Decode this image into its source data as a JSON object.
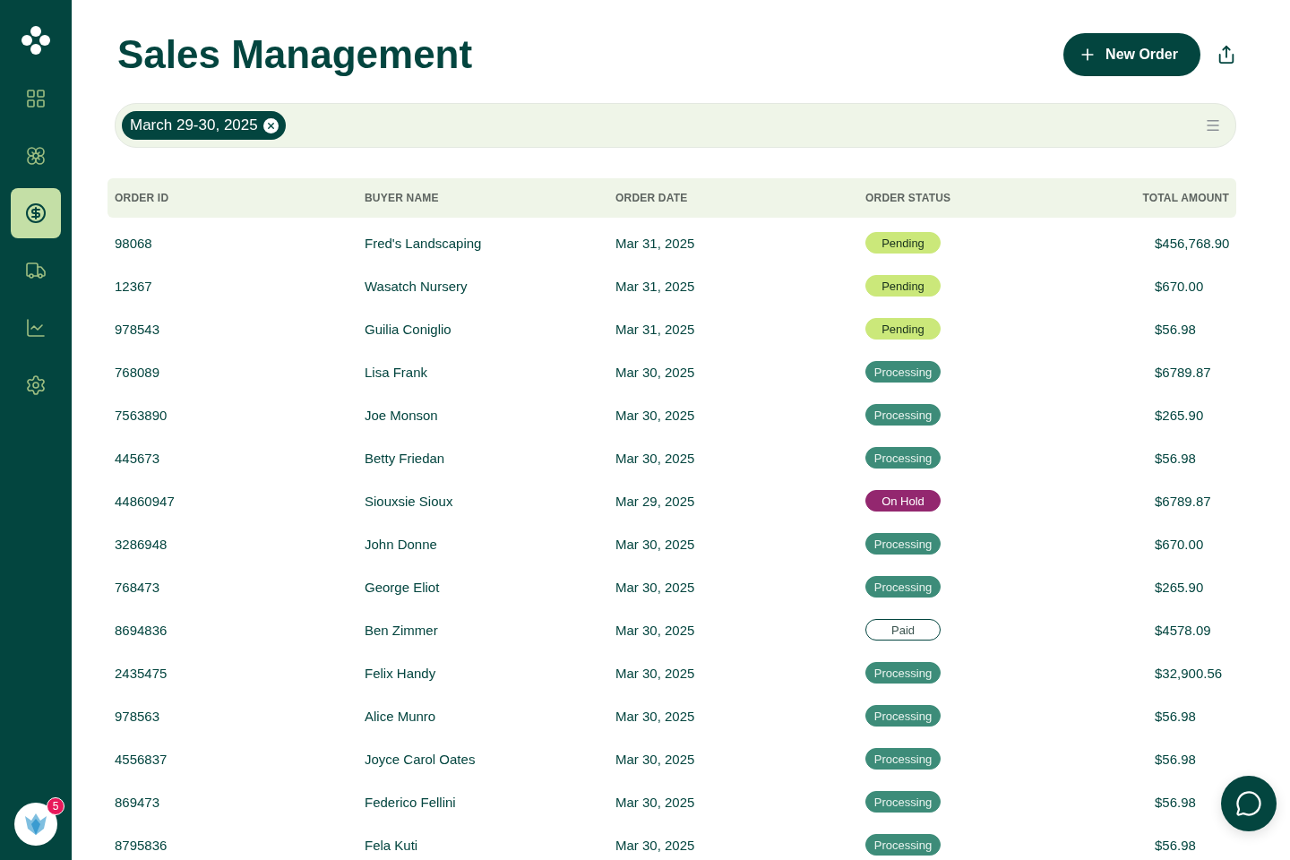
{
  "sidebar": {
    "items": [
      {
        "kind": "grid",
        "selected": false
      },
      {
        "kind": "flower",
        "selected": false
      },
      {
        "kind": "dollar",
        "selected": true
      },
      {
        "kind": "truck",
        "selected": false
      },
      {
        "kind": "chart",
        "selected": false
      },
      {
        "kind": "settings",
        "selected": false
      }
    ],
    "notification_count": "5"
  },
  "header": {
    "title": "Sales Management",
    "new_order_button": "New Order"
  },
  "filter_bar": {
    "chips": [
      "March 29-30, 2025"
    ]
  },
  "table": {
    "columns": [
      "ORDER ID",
      "BUYER NAME",
      "ORDER DATE",
      "ORDER STATUS",
      "TOTAL AMOUNT"
    ],
    "rows": [
      {
        "id": "98068",
        "buyer": "Fred's Landscaping",
        "date": "Mar 31, 2025",
        "status": "Pending",
        "kind": "pending",
        "total": "$456,768.90"
      },
      {
        "id": "12367",
        "buyer": "Wasatch Nursery",
        "date": "Mar 31, 2025",
        "status": "Pending",
        "kind": "pending",
        "total": "$670.00"
      },
      {
        "id": "978543",
        "buyer": "Guilia Coniglio",
        "date": "Mar 31, 2025",
        "status": "Pending",
        "kind": "pending",
        "total": "$56.98"
      },
      {
        "id": "768089",
        "buyer": "Lisa Frank",
        "date": "Mar 30, 2025",
        "status": "Processing",
        "kind": "processing",
        "total": "$6789.87"
      },
      {
        "id": "7563890",
        "buyer": "Joe Monson",
        "date": "Mar 30, 2025",
        "status": "Processing",
        "kind": "processing",
        "total": "$265.90"
      },
      {
        "id": "445673",
        "buyer": "Betty Friedan",
        "date": "Mar 30, 2025",
        "status": "Processing",
        "kind": "processing",
        "total": "$56.98"
      },
      {
        "id": "44860947",
        "buyer": "Siouxsie Sioux",
        "date": "Mar 29, 2025",
        "status": "On Hold",
        "kind": "on_hold",
        "total": "$6789.87"
      },
      {
        "id": "3286948",
        "buyer": "John Donne",
        "date": "Mar 30, 2025",
        "status": "Processing",
        "kind": "processing",
        "total": "$670.00"
      },
      {
        "id": "768473",
        "buyer": "George Eliot",
        "date": "Mar 30, 2025",
        "status": "Processing",
        "kind": "processing",
        "total": "$265.90"
      },
      {
        "id": "8694836",
        "buyer": "Ben Zimmer",
        "date": "Mar 30, 2025",
        "status": "Paid",
        "kind": "paid",
        "total": "$4578.09"
      },
      {
        "id": "2435475",
        "buyer": "Felix Handy",
        "date": "Mar 30, 2025",
        "status": "Processing",
        "kind": "processing",
        "total": "$32,900.56"
      },
      {
        "id": "978563",
        "buyer": "Alice Munro",
        "date": "Mar 30, 2025",
        "status": "Processing",
        "kind": "processing",
        "total": "$56.98"
      },
      {
        "id": "4556837",
        "buyer": "Joyce Carol Oates",
        "date": "Mar 30, 2025",
        "status": "Processing",
        "kind": "processing",
        "total": "$56.98"
      },
      {
        "id": "869473",
        "buyer": "Federico Fellini",
        "date": "Mar 30, 2025",
        "status": "Processing",
        "kind": "processing",
        "total": "$56.98"
      },
      {
        "id": "8795836",
        "buyer": "Fela Kuti",
        "date": "Mar 30, 2025",
        "status": "Processing",
        "kind": "processing",
        "total": "$56.98"
      }
    ]
  }
}
